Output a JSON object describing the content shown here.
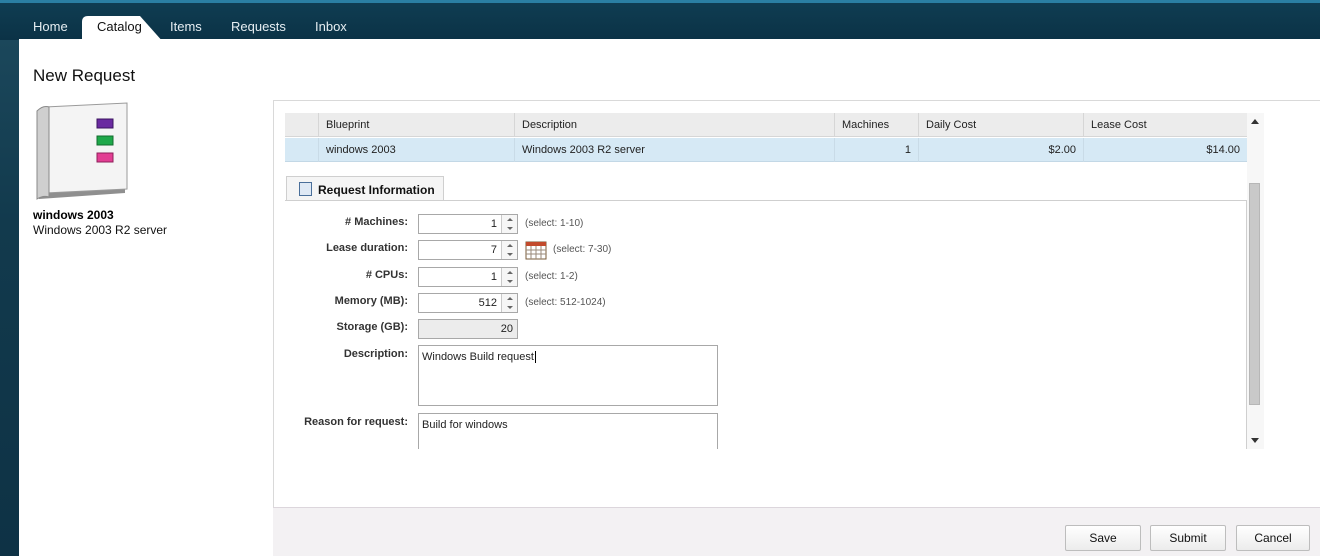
{
  "nav": {
    "tabs": [
      {
        "label": "Home"
      },
      {
        "label": "Catalog"
      },
      {
        "label": "Items"
      },
      {
        "label": "Requests"
      },
      {
        "label": "Inbox"
      }
    ],
    "active": "Catalog"
  },
  "page": {
    "title": "New Request"
  },
  "blueprint": {
    "name": "windows 2003",
    "description": "Windows 2003 R2 server",
    "icon": "book-icon"
  },
  "grid": {
    "headers": [
      "Blueprint",
      "Description",
      "Machines",
      "Daily Cost",
      "Lease Cost"
    ],
    "row": {
      "blueprint": "windows 2003",
      "description": "Windows 2003 R2 server",
      "machines": "1",
      "daily_cost": "$2.00",
      "lease_cost": "$14.00"
    }
  },
  "form": {
    "tab_label": "Request Information",
    "machines": {
      "label": "# Machines:",
      "value": "1",
      "hint": "(select: 1-10)"
    },
    "lease": {
      "label": "Lease duration:",
      "value": "7",
      "hint": "(select: 7-30)"
    },
    "cpus": {
      "label": "# CPUs:",
      "value": "1",
      "hint": "(select: 1-2)"
    },
    "memory": {
      "label": "Memory (MB):",
      "value": "512",
      "hint": "(select: 512-1024)"
    },
    "storage": {
      "label": "Storage (GB):",
      "value": "20"
    },
    "description": {
      "label": "Description:",
      "value": "Windows Build request"
    },
    "reason": {
      "label": "Reason for request:",
      "value": "Build for windows"
    }
  },
  "footer": {
    "save": "Save",
    "submit": "Submit",
    "cancel": "Cancel"
  },
  "colors": {
    "nav_bg": "#0f3d52",
    "row_selected": "#d6e9f5",
    "footer_bg": "#f3f1f3"
  }
}
